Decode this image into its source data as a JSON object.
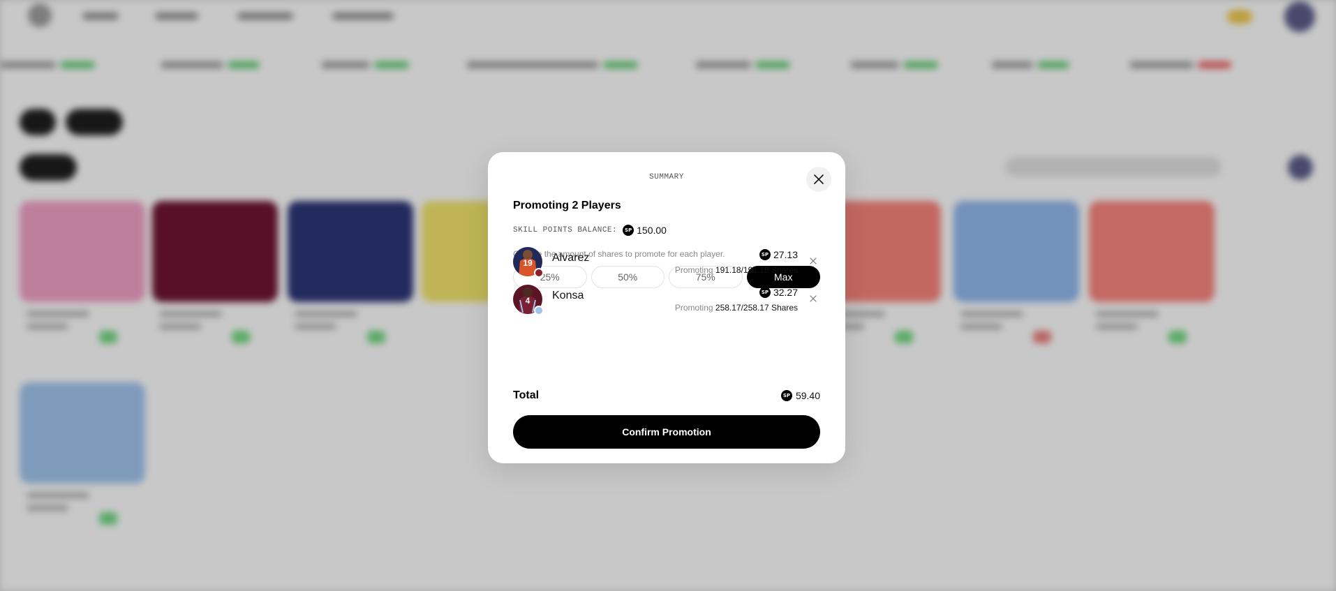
{
  "modal": {
    "header": "SUMMARY",
    "title": "Promoting 2 Players",
    "balance_label": "SKILL POINTS BALANCE:",
    "balance_value": "150.00",
    "currency_icon": "SP",
    "hint": "Choose the amount of shares to promote for each player.",
    "percent_options": [
      {
        "label": "25%",
        "selected": false
      },
      {
        "label": "50%",
        "selected": false
      },
      {
        "label": "75%",
        "selected": false
      },
      {
        "label": "Max",
        "selected": true
      }
    ],
    "players": [
      {
        "name": "Alvarez",
        "amount": "27.13",
        "promoting_label": "Promoting",
        "shares": "191.18/191.18 Shares",
        "jersey_number": "19",
        "avatar_colors": {
          "bg": "#1f2a5a",
          "shirt": "#d9542b",
          "badge": "#8b1e2d"
        }
      },
      {
        "name": "Konsa",
        "amount": "32.27",
        "promoting_label": "Promoting",
        "shares": "258.17/258.17 Shares",
        "jersey_number": "4",
        "avatar_colors": {
          "bg": "#5a1424",
          "shirt": "#6b1a2e",
          "badge": "#9fc2e6"
        }
      }
    ],
    "total_label": "Total",
    "total_amount": "59.40",
    "confirm_label": "Confirm Promotion"
  },
  "colors": {
    "accent": "#000000",
    "muted_text": "#888888",
    "overlay": "rgba(0,0,0,0.18)"
  }
}
